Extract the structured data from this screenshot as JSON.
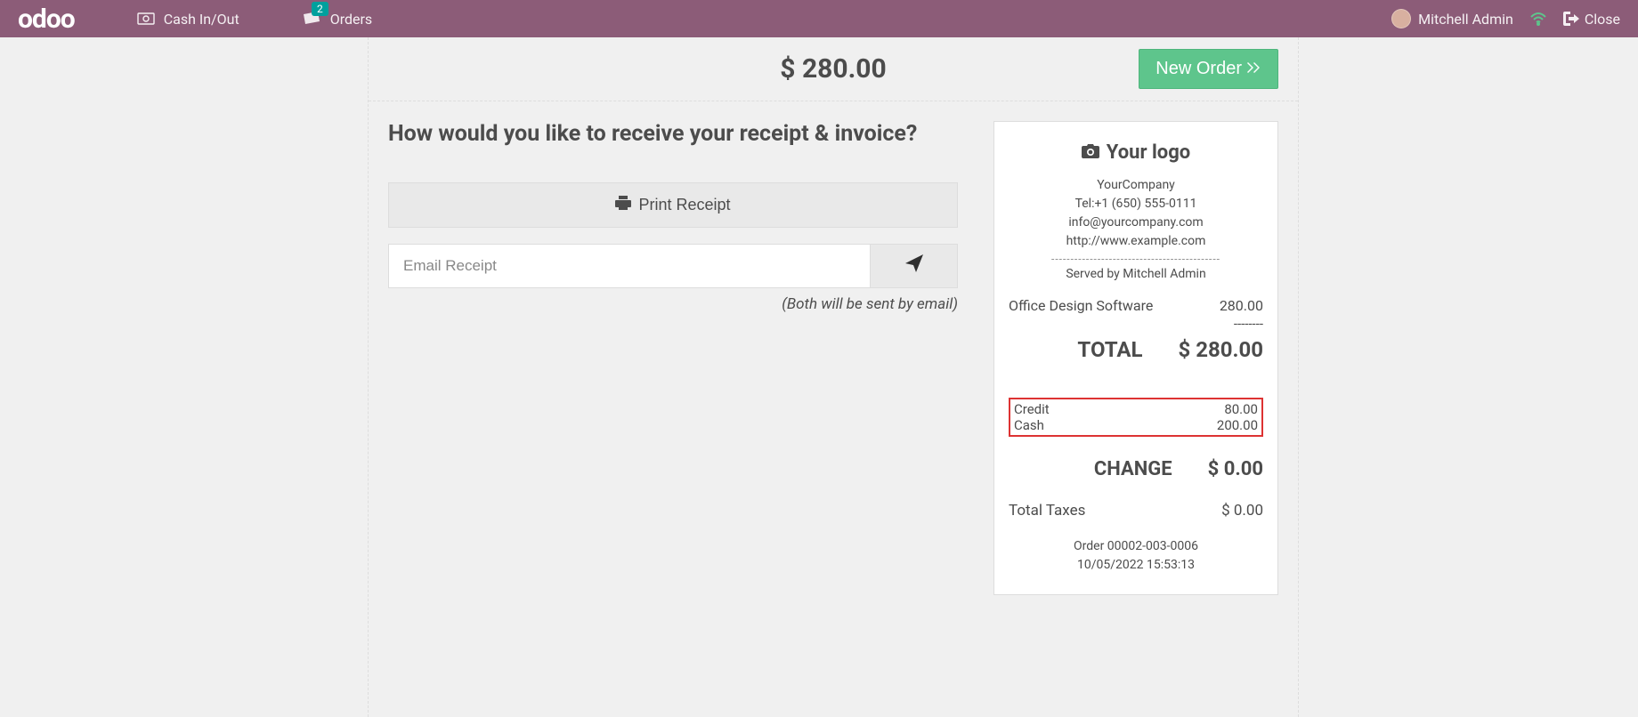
{
  "navbar": {
    "brand": "odoo",
    "cash_label": "Cash In/Out",
    "orders_label": "Orders",
    "orders_badge": "2",
    "user_name": "Mitchell Admin",
    "close_label": "Close"
  },
  "main": {
    "amount": "$ 280.00",
    "new_order_label": "New Order",
    "question": "How would you like to receive your receipt & invoice?",
    "print_label": "Print Receipt",
    "email_placeholder": "Email Receipt",
    "hint": "(Both will be sent by email)"
  },
  "receipt": {
    "logo_text": "Your logo",
    "company_name": "YourCompany",
    "tel": "Tel:+1 (650) 555-0111",
    "email": "info@yourcompany.com",
    "url": "http://www.example.com",
    "served_by": "Served by Mitchell Admin",
    "lines": [
      {
        "name": "Office Design Software",
        "amount": "280.00"
      }
    ],
    "total_label": "TOTAL",
    "total_value": "$ 280.00",
    "payments": [
      {
        "name": "Credit",
        "amount": "80.00"
      },
      {
        "name": "Cash",
        "amount": "200.00"
      }
    ],
    "change_label": "CHANGE",
    "change_value": "$ 0.00",
    "taxes_label": "Total Taxes",
    "taxes_value": "$ 0.00",
    "order_ref": "Order 00002-003-0006",
    "order_date": "10/05/2022 15:53:13"
  }
}
